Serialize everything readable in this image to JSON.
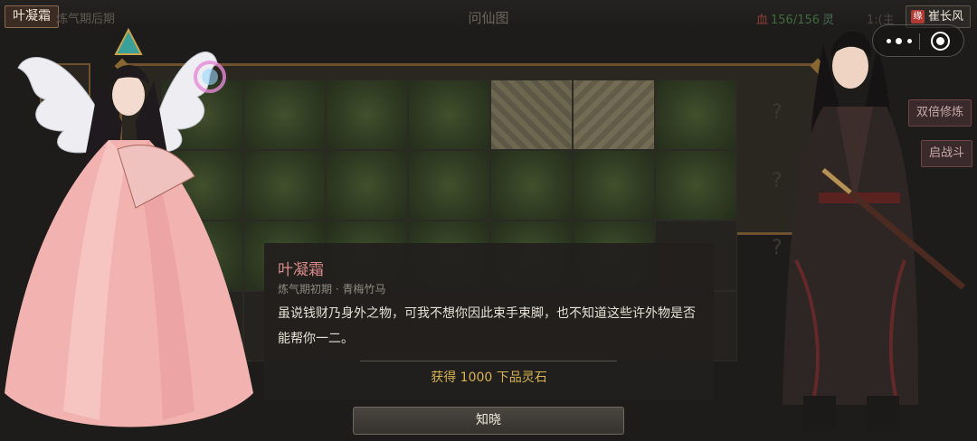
{
  "topbar": {
    "player_name": "叶凝霜",
    "realm": "炼气期后期",
    "title": "问仙图",
    "hp_icon": "血",
    "hp": "156/156",
    "ling": "灵",
    "extra": "1:(主",
    "partner_badge": "缘",
    "partner_name": "崔长风"
  },
  "board": {
    "question_mark": "?"
  },
  "side_buttons": {
    "double_cultivate": "双倍修炼",
    "start_battle": "启战斗"
  },
  "dialog": {
    "speaker": "叶凝霜",
    "subtitle": "炼气期初期 · 青梅竹马",
    "body": "虽说钱财乃身外之物，可我不想你因此束手束脚，也不知道这些许外物是否能帮你一二。",
    "reward": "获得 1000 下品灵石",
    "confirm": "知晓"
  },
  "colors": {
    "speaker": "#d98a8a",
    "reward": "#d8b34f",
    "board_border": "#6e5230"
  },
  "icons": [
    "menu-dots-icon",
    "record-target-icon",
    "yuan-badge-icon"
  ]
}
